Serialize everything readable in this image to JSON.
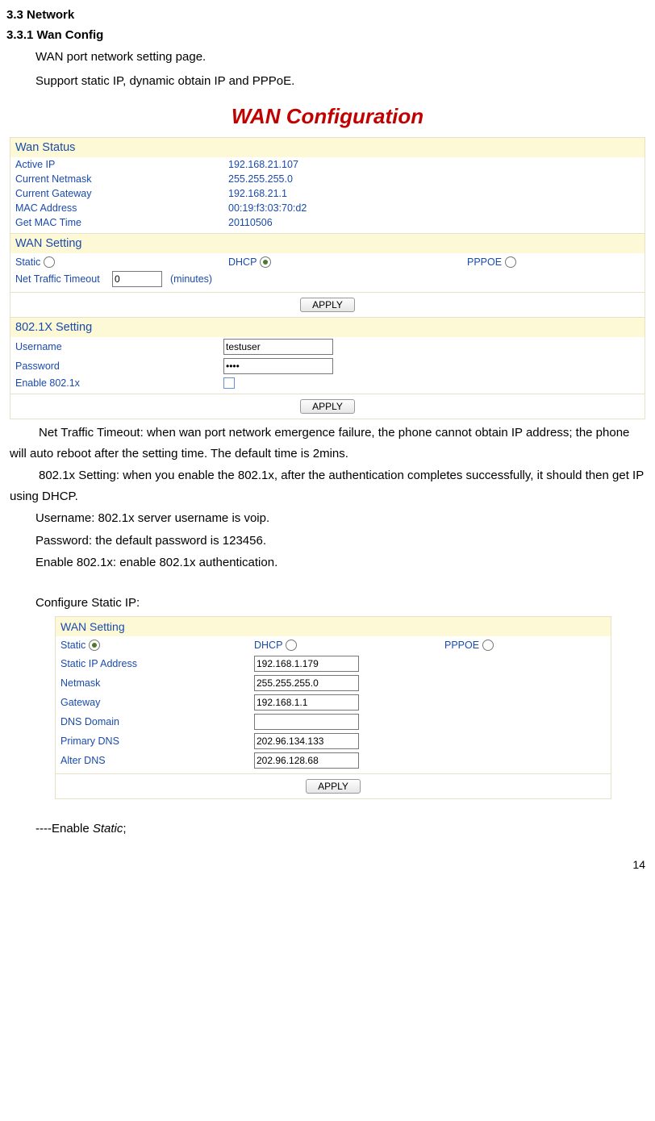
{
  "headings": {
    "h1": "3.3 Network",
    "h2": "3.3.1 Wan Config",
    "intro1": "WAN port network setting page.",
    "intro2": "Support static IP, dynamic obtain IP and PPPoE."
  },
  "page_title": "WAN Configuration",
  "wan_status": {
    "header": "Wan Status",
    "rows": [
      {
        "label": "Active IP",
        "value": "192.168.21.107"
      },
      {
        "label": "Current Netmask",
        "value": "255.255.255.0"
      },
      {
        "label": "Current Gateway",
        "value": "192.168.21.1"
      },
      {
        "label": "MAC Address",
        "value": "00:19:f3:03:70:d2"
      },
      {
        "label": "Get MAC Time",
        "value": "20110506"
      }
    ]
  },
  "wan_setting": {
    "header": "WAN Setting",
    "options": {
      "static": "Static",
      "dhcp": "DHCP",
      "pppoe": "PPPOE"
    },
    "timeout_label": "Net Traffic Timeout",
    "timeout_value": "0",
    "timeout_unit": "(minutes)",
    "apply": "APPLY"
  },
  "setting_8021x": {
    "header": "802.1X Setting",
    "username_label": "Username",
    "username_value": "testuser",
    "password_label": "Password",
    "password_value": "••••",
    "enable_label": "Enable 802.1x",
    "apply": "APPLY"
  },
  "explanation": {
    "p1": "Net Traffic Timeout: when wan port network emergence failure, the phone cannot obtain IP address; the phone will auto reboot after the setting time. The default time is 2mins.",
    "p2": "802.1x Setting: when you enable the 802.1x, after the authentication completes successfully, it should then get IP using DHCP.",
    "p3": "Username: 802.1x server username is voip.",
    "p4": "Password: the default password is 123456.",
    "p5": "Enable 802.1x: enable 802.1x authentication."
  },
  "configure_static": "Configure Static IP:",
  "wan_setting2": {
    "header": "WAN Setting",
    "options": {
      "static": "Static",
      "dhcp": "DHCP",
      "pppoe": "PPPOE"
    },
    "fields": {
      "static_ip": {
        "label": "Static IP Address",
        "value": "192.168.1.179"
      },
      "netmask": {
        "label": "Netmask",
        "value": "255.255.255.0"
      },
      "gateway": {
        "label": "Gateway",
        "value": "192.168.1.1"
      },
      "dns_domain": {
        "label": "DNS Domain",
        "value": ""
      },
      "primary_dns": {
        "label": "Primary DNS",
        "value": "202.96.134.133"
      },
      "alter_dns": {
        "label": "Alter DNS",
        "value": "202.96.128.68"
      }
    },
    "apply": "APPLY"
  },
  "enable_static_prefix": "----Enable ",
  "enable_static_italic": "Static",
  "enable_static_suffix": ";",
  "page_number": "14"
}
